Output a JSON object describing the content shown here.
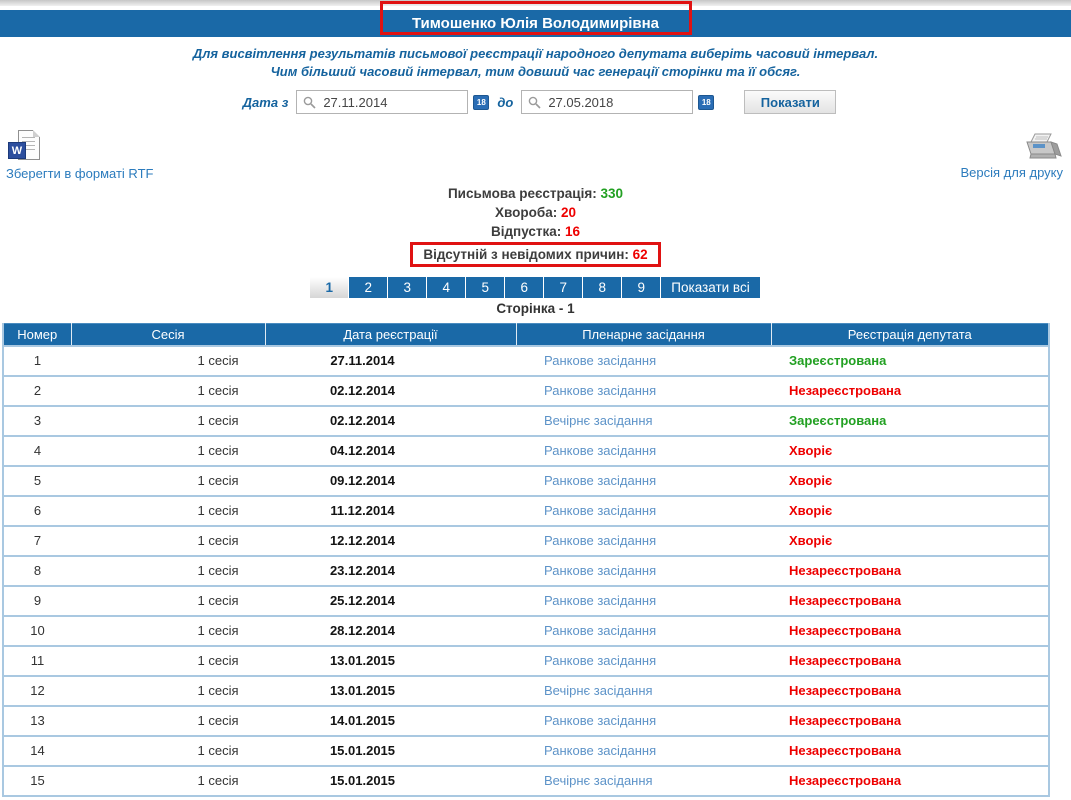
{
  "header": {
    "title": "Тимошенко Юлія Володимирівна"
  },
  "instructions": {
    "line1": "Для висвітлення результатів письмової реєстрації народного депутата виберіть часовий інтервал.",
    "line2": "Чим більший часовий інтервал, тим довший час генерації сторінки та її обсяг."
  },
  "filter": {
    "date_from_label": "Дата з",
    "date_to_label": "до",
    "date_from": "27.11.2014",
    "date_to": "27.05.2018",
    "calendar_day": "18",
    "show_button": "Показати"
  },
  "export": {
    "rtf_label": "Зберегти в форматі RTF",
    "word_letter": "W",
    "print_label": "Версія для друку"
  },
  "summary": {
    "items": [
      {
        "label": "Письмова реєстрація:",
        "value": "330",
        "value_class": "green",
        "boxed": false
      },
      {
        "label": "Хвороба:",
        "value": "20",
        "value_class": "red",
        "boxed": false
      },
      {
        "label": "Відпустка:",
        "value": "16",
        "value_class": "red",
        "boxed": false
      },
      {
        "label": "Відсутній з невідомих причин:",
        "value": "62",
        "value_class": "red",
        "boxed": true
      }
    ]
  },
  "pagination": {
    "pages": [
      "1",
      "2",
      "3",
      "4",
      "5",
      "6",
      "7",
      "8",
      "9"
    ],
    "active": "1",
    "show_all_label": "Показати всі",
    "page_label": "Сторінка - 1"
  },
  "table": {
    "headers": [
      "Номер",
      "Сесія",
      "Дата реєстрації",
      "Пленарне засідання",
      "Реєстрація депутата"
    ],
    "rows": [
      {
        "num": "1",
        "session": "1 сесія",
        "date": "27.11.2014",
        "meeting": "Ранкове засідання",
        "status": "Зареєстрована",
        "status_class": "green"
      },
      {
        "num": "2",
        "session": "1 сесія",
        "date": "02.12.2014",
        "meeting": "Ранкове засідання",
        "status": "Незареєстрована",
        "status_class": "red"
      },
      {
        "num": "3",
        "session": "1 сесія",
        "date": "02.12.2014",
        "meeting": "Вечірнє засідання",
        "status": "Зареєстрована",
        "status_class": "green"
      },
      {
        "num": "4",
        "session": "1 сесія",
        "date": "04.12.2014",
        "meeting": "Ранкове засідання",
        "status": "Хворіє",
        "status_class": "red"
      },
      {
        "num": "5",
        "session": "1 сесія",
        "date": "09.12.2014",
        "meeting": "Ранкове засідання",
        "status": "Хворіє",
        "status_class": "red"
      },
      {
        "num": "6",
        "session": "1 сесія",
        "date": "11.12.2014",
        "meeting": "Ранкове засідання",
        "status": "Хворіє",
        "status_class": "red"
      },
      {
        "num": "7",
        "session": "1 сесія",
        "date": "12.12.2014",
        "meeting": "Ранкове засідання",
        "status": "Хворіє",
        "status_class": "red"
      },
      {
        "num": "8",
        "session": "1 сесія",
        "date": "23.12.2014",
        "meeting": "Ранкове засідання",
        "status": "Незареєстрована",
        "status_class": "red"
      },
      {
        "num": "9",
        "session": "1 сесія",
        "date": "25.12.2014",
        "meeting": "Ранкове засідання",
        "status": "Незареєстрована",
        "status_class": "red"
      },
      {
        "num": "10",
        "session": "1 сесія",
        "date": "28.12.2014",
        "meeting": "Ранкове засідання",
        "status": "Незареєстрована",
        "status_class": "red"
      },
      {
        "num": "11",
        "session": "1 сесія",
        "date": "13.01.2015",
        "meeting": "Ранкове засідання",
        "status": "Незареєстрована",
        "status_class": "red"
      },
      {
        "num": "12",
        "session": "1 сесія",
        "date": "13.01.2015",
        "meeting": "Вечірнє засідання",
        "status": "Незареєстрована",
        "status_class": "red"
      },
      {
        "num": "13",
        "session": "1 сесія",
        "date": "14.01.2015",
        "meeting": "Ранкове засідання",
        "status": "Незареєстрована",
        "status_class": "red"
      },
      {
        "num": "14",
        "session": "1 сесія",
        "date": "15.01.2015",
        "meeting": "Ранкове засідання",
        "status": "Незареєстрована",
        "status_class": "red"
      },
      {
        "num": "15",
        "session": "1 сесія",
        "date": "15.01.2015",
        "meeting": "Вечірнє засідання",
        "status": "Незареєстрована",
        "status_class": "red"
      }
    ]
  },
  "colors": {
    "accent_blue": "#1a69a7",
    "label_blue": "#15639e",
    "link_blue": "#2b7bbd",
    "table_link_blue": "#5d93c8",
    "row_border_blue": "#a9c8e1",
    "status_green": "#22a022",
    "status_red": "#ee0000",
    "highlight_red": "#e01212"
  }
}
